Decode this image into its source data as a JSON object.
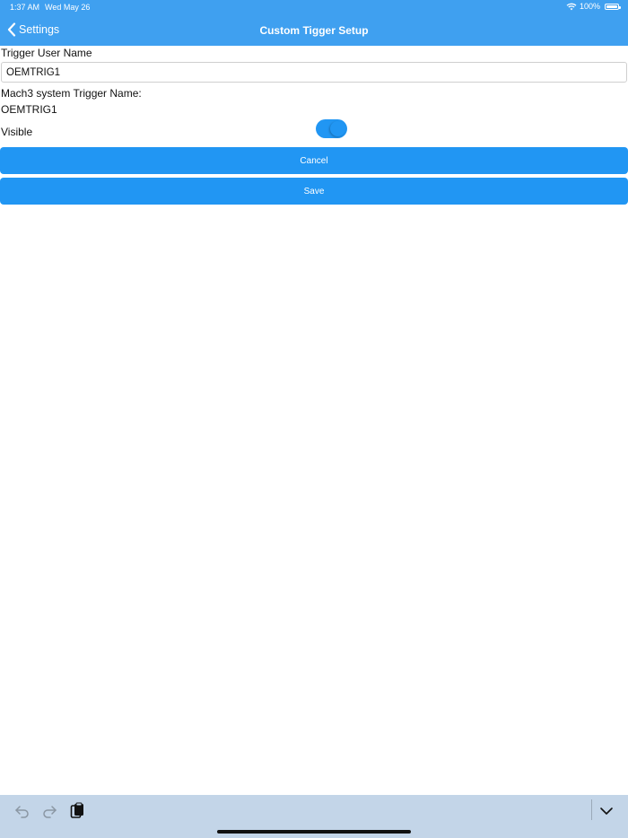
{
  "status_bar": {
    "time": "1:37 AM",
    "date": "Wed May 26",
    "battery": "100%",
    "wifi_icon": "wifi-icon",
    "battery_icon": "battery-icon"
  },
  "nav": {
    "back_label": "Settings",
    "back_icon": "chevron-left-icon",
    "title": "Custom Tigger Setup"
  },
  "form": {
    "trigger_user_name_label": "Trigger User Name",
    "trigger_user_name_value": "OEMTRIG1",
    "system_trigger_label": "Mach3 system Trigger Name:",
    "system_trigger_value": "OEMTRIG1",
    "visible_label": "Visible",
    "visible_on": true
  },
  "buttons": {
    "cancel": "Cancel",
    "save": "Save"
  },
  "toolbar": {
    "icons": [
      "undo-icon",
      "redo-icon",
      "paste-icon",
      "keyboard-dismiss-icon"
    ]
  },
  "colors": {
    "header": "#3fa0f0",
    "accent": "#2196f3",
    "toolbar": "#c3d5e8"
  }
}
